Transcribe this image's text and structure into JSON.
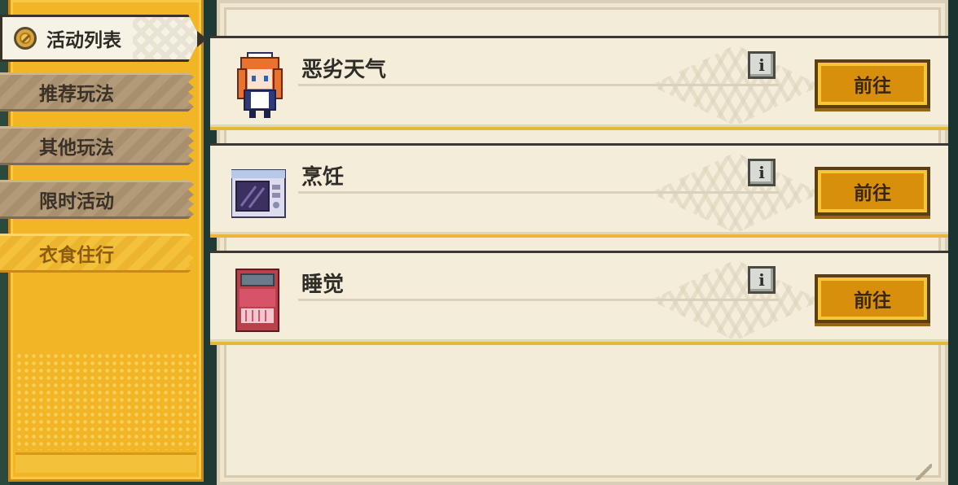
{
  "sidebar": {
    "header_label": "活动列表",
    "items": [
      {
        "label": "推荐玩法",
        "active": false
      },
      {
        "label": "其他玩法",
        "active": false
      },
      {
        "label": "限时活动",
        "active": false
      },
      {
        "label": "衣食住行",
        "active": true
      }
    ]
  },
  "activities": [
    {
      "title": "恶劣天气",
      "icon": "maid-character-icon",
      "info_icon": "i",
      "button_label": "前往"
    },
    {
      "title": "烹饪",
      "icon": "microwave-icon",
      "info_icon": "i",
      "button_label": "前往"
    },
    {
      "title": "睡觉",
      "icon": "bed-icon",
      "info_icon": "i",
      "button_label": "前往"
    }
  ],
  "colors": {
    "accent_yellow": "#f2b526",
    "button_orange": "#d88f0c",
    "panel_cream": "#f3ecd8"
  }
}
